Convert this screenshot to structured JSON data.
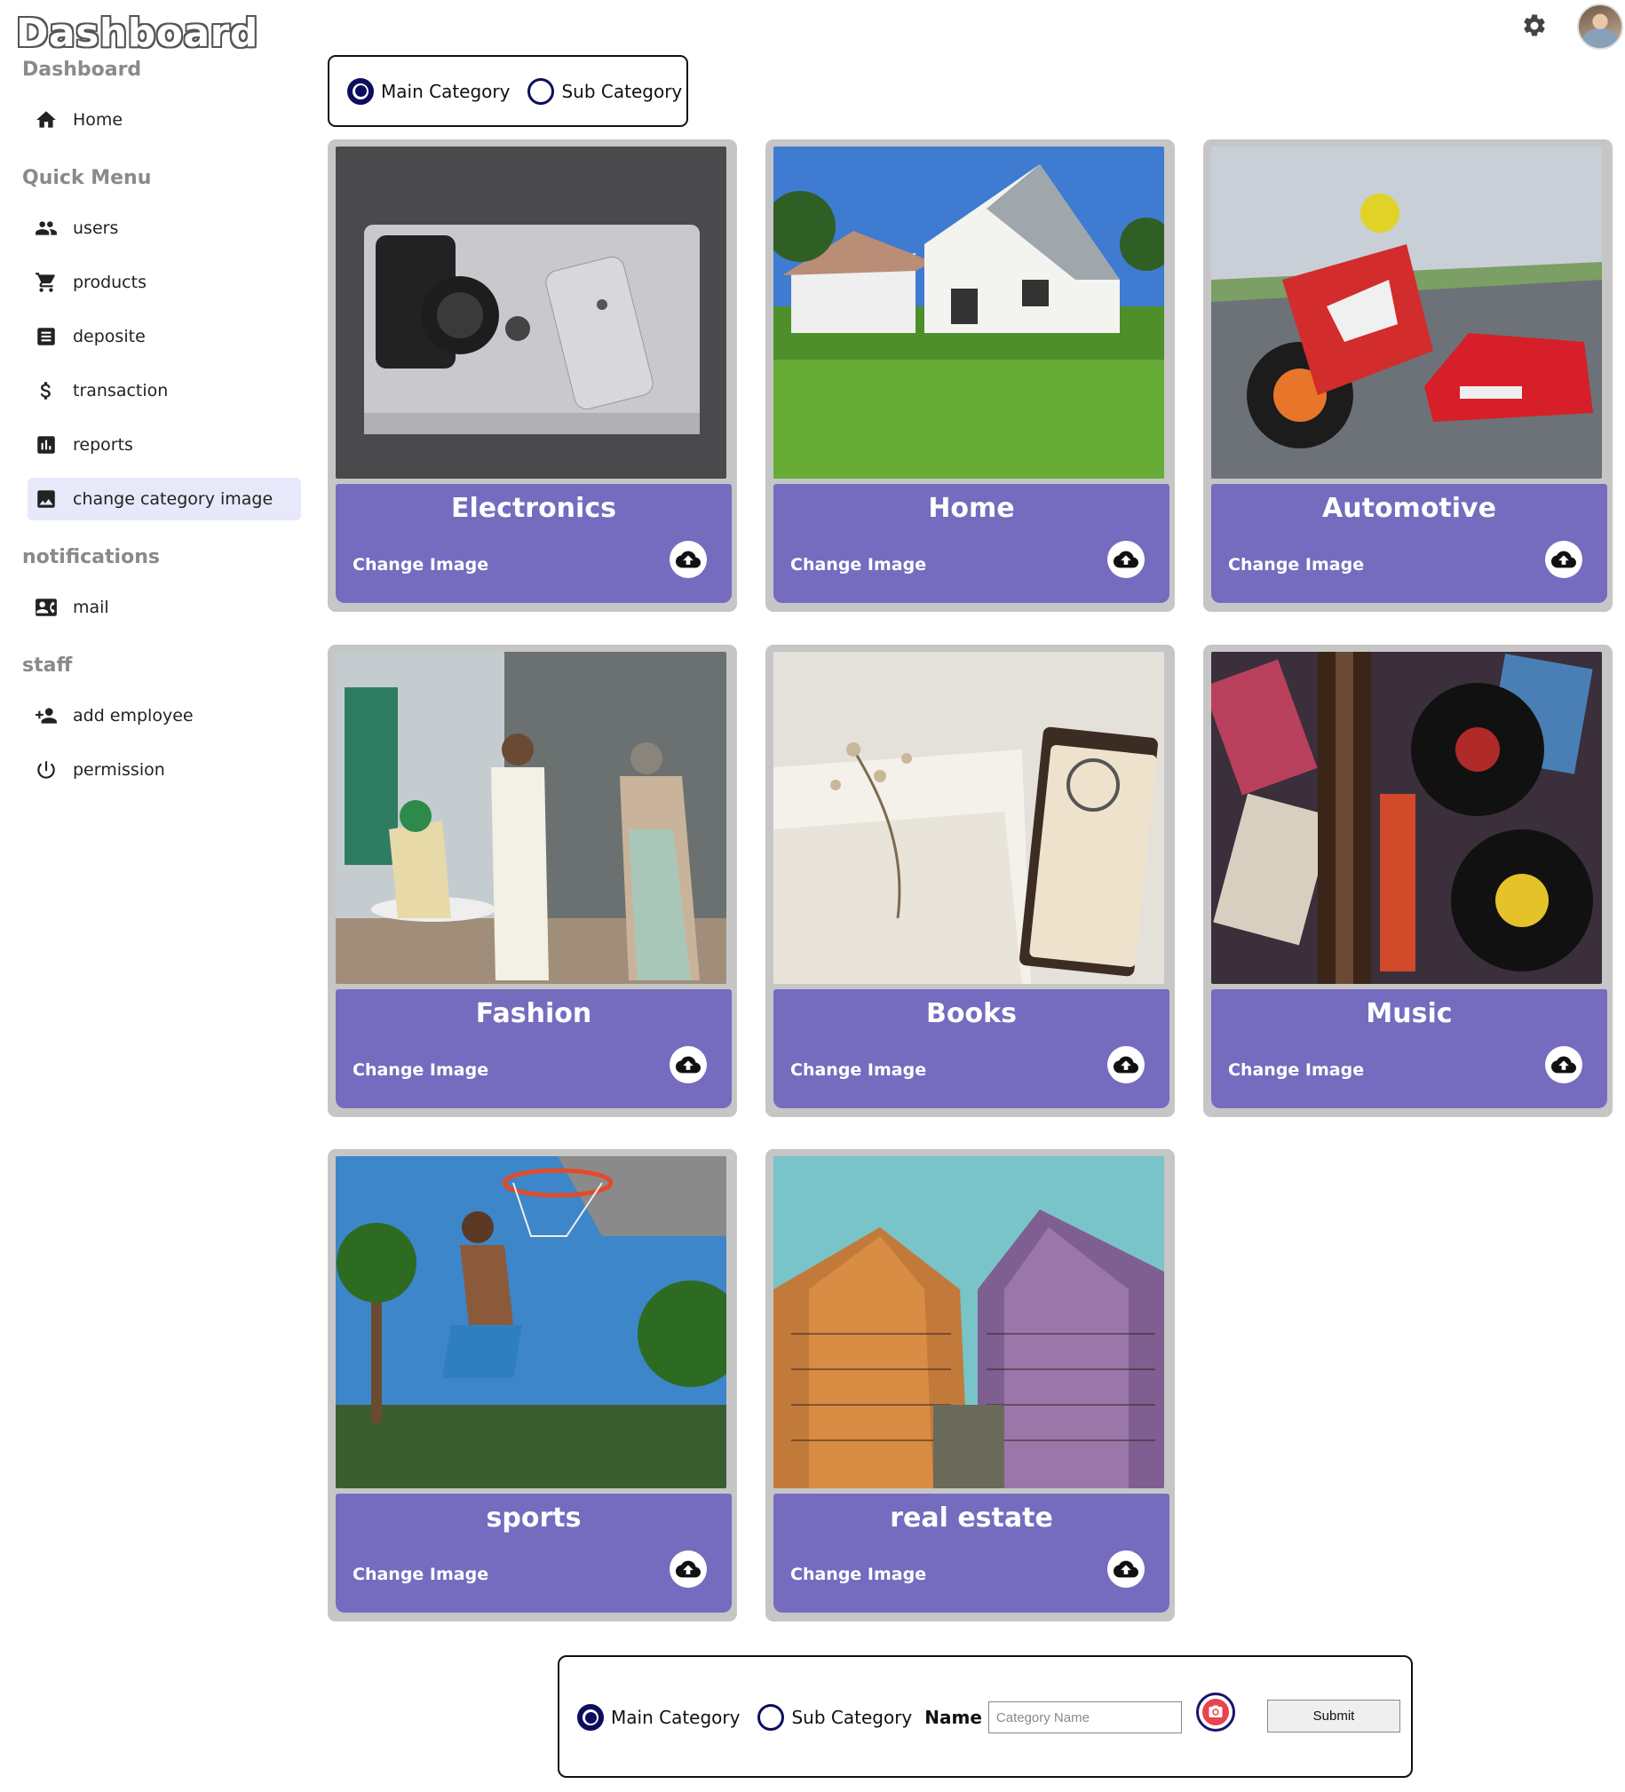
{
  "app": {
    "brand": "Dashboard"
  },
  "header": {
    "settings_icon": "gear-icon",
    "avatar": "avatar"
  },
  "sidebar": {
    "sections": [
      {
        "title": "Dashboard",
        "items": [
          {
            "label": "Home",
            "icon": "home-icon"
          }
        ]
      },
      {
        "title": "Quick Menu",
        "items": [
          {
            "label": "users",
            "icon": "users-icon"
          },
          {
            "label": "products",
            "icon": "cart-icon"
          },
          {
            "label": "deposite",
            "icon": "receipt-icon"
          },
          {
            "label": "transaction",
            "icon": "dollar-icon"
          },
          {
            "label": "reports",
            "icon": "chart-icon"
          },
          {
            "label": "change category image",
            "icon": "image-icon",
            "active": true
          }
        ]
      },
      {
        "title": "notifications",
        "items": [
          {
            "label": "mail",
            "icon": "contact-card-icon"
          }
        ]
      },
      {
        "title": "staff",
        "items": [
          {
            "label": "add employee",
            "icon": "person-add-icon"
          },
          {
            "label": "permission",
            "icon": "power-icon"
          }
        ]
      }
    ]
  },
  "category_toggle": {
    "options": [
      {
        "label": "Main Category",
        "selected": true
      },
      {
        "label": "Sub Category",
        "selected": false
      }
    ]
  },
  "cards": [
    {
      "name": "Electronics",
      "action": "Change Image",
      "image": "laptop-camera-phone-photo"
    },
    {
      "name": "Home",
      "action": "Change Image",
      "image": "house-lawn-photo"
    },
    {
      "name": "Automotive",
      "action": "Change Image",
      "image": "motorbike-car-photo"
    },
    {
      "name": "Fashion",
      "action": "Change Image",
      "image": "people-fashion-photo"
    },
    {
      "name": "Books",
      "action": "Change Image",
      "image": "open-book-glasses-photo"
    },
    {
      "name": "Music",
      "action": "Change Image",
      "image": "guitar-vinyl-photo"
    },
    {
      "name": "sports",
      "action": "Change Image",
      "image": "basketball-dunk-photo"
    },
    {
      "name": "real estate",
      "action": "Change Image",
      "image": "skyscrapers-photo"
    }
  ],
  "form": {
    "options": [
      {
        "label": "Main Category",
        "selected": true
      },
      {
        "label": "Sub Category",
        "selected": false
      }
    ],
    "name_label": "Name",
    "name_placeholder": "Category Name",
    "submit_label": "Submit",
    "camera_icon": "camera-icon"
  },
  "colors": {
    "card_panel": "#756cbf",
    "card_frame": "#c6c6c6",
    "active_nav": "#e8e8fb",
    "radio": "#0d0d5e",
    "camera": "#e8434f"
  }
}
